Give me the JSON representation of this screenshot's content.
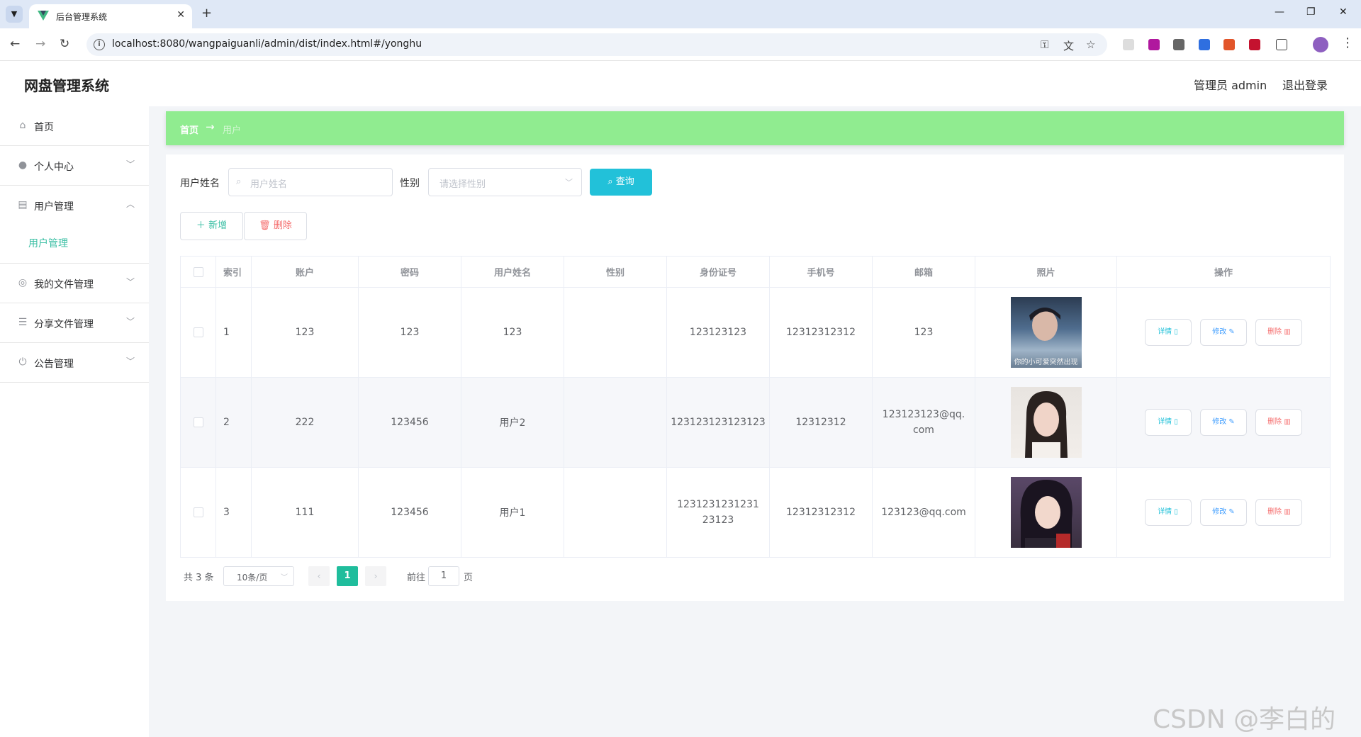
{
  "browser": {
    "tab_title": "后台管理系统",
    "url": "localhost:8080/wangpaiguanli/admin/dist/index.html#/yonghu"
  },
  "header": {
    "app_title": "网盘管理系统",
    "admin_label": "管理员 admin",
    "logout_label": "退出登录"
  },
  "sidebar": {
    "items": [
      {
        "label": "首页",
        "icon": "home-icon"
      },
      {
        "label": "个人中心",
        "icon": "user-icon"
      },
      {
        "label": "用户管理",
        "icon": "clipboard-icon"
      },
      {
        "label": "用户管理",
        "icon": ""
      },
      {
        "label": "我的文件管理",
        "icon": "compass-icon"
      },
      {
        "label": "分享文件管理",
        "icon": "list-icon"
      },
      {
        "label": "公告管理",
        "icon": "power-icon"
      }
    ]
  },
  "breadcrumb": {
    "home": "首页",
    "separator": "→",
    "current": "用户"
  },
  "search": {
    "name_label": "用户姓名",
    "name_placeholder": "用户姓名",
    "gender_label": "性别",
    "gender_placeholder": "请选择性别",
    "query_button": "查询"
  },
  "actions": {
    "add_button": "新增",
    "delete_button": "删除"
  },
  "table": {
    "columns": [
      "索引",
      "账户",
      "密码",
      "用户姓名",
      "性别",
      "身份证号",
      "手机号",
      "邮箱",
      "照片",
      "操作"
    ],
    "rows": [
      {
        "index": "1",
        "account": "123",
        "password": "123",
        "name": "123",
        "gender": "",
        "id_card": "123123123",
        "phone": "12312312312",
        "email": "123",
        "photo_caption": "你的小可爱突然出现"
      },
      {
        "index": "2",
        "account": "222",
        "password": "123456",
        "name": "用户2",
        "gender": "",
        "id_card": "123123123123123",
        "phone": "12312312",
        "email": "123123123@qq.com",
        "photo_caption": ""
      },
      {
        "index": "3",
        "account": "111",
        "password": "123456",
        "name": "用户1",
        "gender": "",
        "id_card": "123123123123123123",
        "phone": "12312312312",
        "email": "123123@qq.com",
        "photo_caption": ""
      }
    ],
    "row_actions": {
      "detail": "详情",
      "edit": "修改",
      "delete": "删除"
    }
  },
  "pagination": {
    "total": "共 3 条",
    "page_size": "10条/页",
    "current_page": "1",
    "goto_label": "前往",
    "goto_value": "1",
    "page_suffix": "页"
  },
  "watermark": "CSDN @李白的粉",
  "colors": {
    "breadcrumb_bg": "#90ec90",
    "query_button": "#22c1d9",
    "active_page": "#1fbd9c",
    "delete_red": "#f56c6c",
    "active_submenu": "#3bbfa4"
  }
}
